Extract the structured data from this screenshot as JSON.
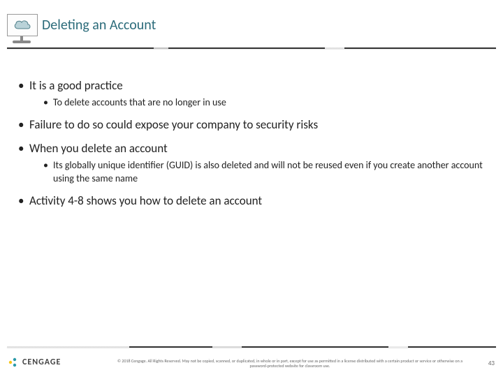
{
  "header": {
    "title": "Deleting an Account",
    "icon": "cloud-icon"
  },
  "body": {
    "bullets": [
      {
        "text": "It is a good practice",
        "sub": [
          "To delete accounts that are no longer in use"
        ]
      },
      {
        "text": "Failure to do so could expose your company to security risks",
        "sub": []
      },
      {
        "text": "When you delete an account",
        "sub": [
          "Its globally unique identifier (GUID) is also deleted and will not be reused even if you create another account using the same name"
        ]
      },
      {
        "text": "Activity 4-8 shows you how to delete an account",
        "sub": []
      }
    ]
  },
  "footer": {
    "brand": "CENGAGE",
    "copyright": "© 2018 Cengage. All Rights Reserved. May not be copied, scanned, or duplicated, in whole or in part, except for use as permitted in a license distributed with a certain product or service or otherwise on a password-protected website for classroom use.",
    "page": "43"
  }
}
